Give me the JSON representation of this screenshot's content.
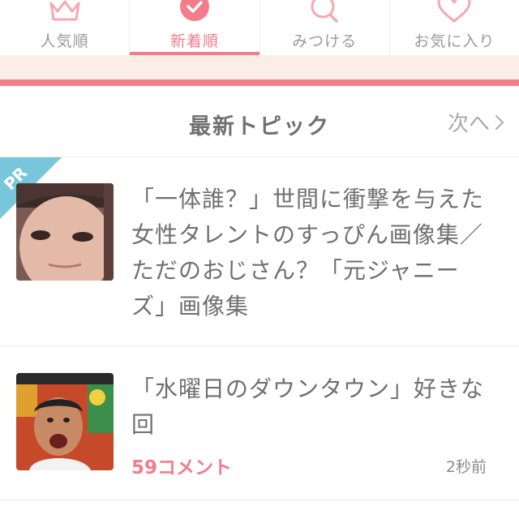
{
  "tabs": [
    {
      "label": "人気順",
      "icon": "crown-icon",
      "active": false
    },
    {
      "label": "新着順",
      "icon": "check-circle-icon",
      "active": true
    },
    {
      "label": "みつける",
      "icon": "search-icon",
      "active": false
    },
    {
      "label": "お気に入り",
      "icon": "heart-icon",
      "active": false
    }
  ],
  "section": {
    "title": "最新トピック",
    "next_label": "次へ",
    "next_icon": "chevron-right-icon"
  },
  "items": [
    {
      "badge": "PR",
      "title": "「一体誰？」世間に衝撃を与えた女性タレントのすっぴん画像集／ただのおじさん？「元ジャニーズ」画像集"
    },
    {
      "title": "「水曜日のダウンタウン」好きな回",
      "comments": "59コメント",
      "time": "2秒前"
    }
  ],
  "colors": {
    "accent": "#f47d8c",
    "cream": "#fbeee6",
    "pr_badge": "#78c6dc",
    "icon_pink": "#f6a8b3",
    "text": "#6f6f6f"
  }
}
